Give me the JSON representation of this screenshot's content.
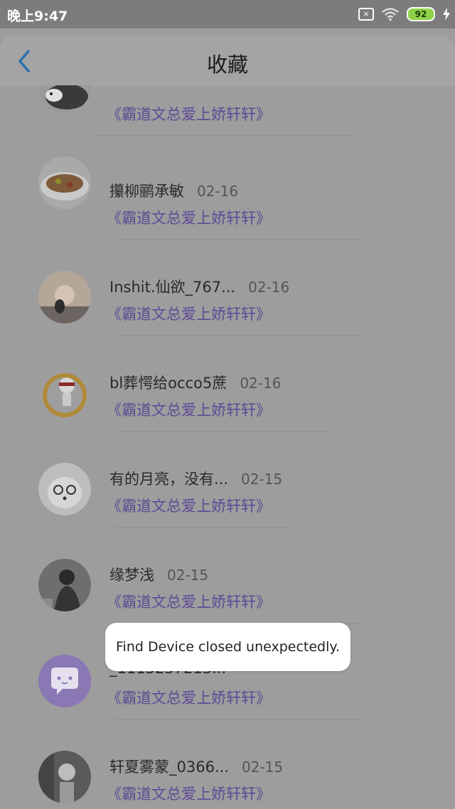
{
  "status": {
    "time": "晚上9:47",
    "battery": "92",
    "sim_label": "×"
  },
  "header": {
    "title": "收藏"
  },
  "items": [
    {
      "name": "",
      "date": "",
      "book": "《霸道文总爱上娇轩轩》"
    },
    {
      "name": "攥柳鹂承敏",
      "date": "02-16",
      "book": "《霸道文总爱上娇轩轩》"
    },
    {
      "name": "Inshit.仙欲_767...",
      "date": "02-16",
      "book": "《霸道文总爱上娇轩轩》"
    },
    {
      "name": "bl葬愕给occo5蔗",
      "date": "02-16",
      "book": "《霸道文总爱上娇轩轩》"
    },
    {
      "name": "有的月亮，没有...",
      "date": "02-15",
      "book": "《霸道文总爱上娇轩轩》"
    },
    {
      "name": "缘梦浅",
      "date": "02-15",
      "book": "《霸道文总爱上娇轩轩》"
    },
    {
      "name": "_1115237213...",
      "date": "",
      "book": "《霸道文总爱上娇轩轩》"
    },
    {
      "name": "轩夏雾蒙_0366...",
      "date": "02-15",
      "book": "《霸道文总爱上娇轩轩》"
    }
  ],
  "toast": {
    "message": "Find Device closed unexpectedly."
  },
  "colors": {
    "accent": "#2d6fb0",
    "book_link": "#5c4a96",
    "scrim": "#9d9d9d"
  }
}
